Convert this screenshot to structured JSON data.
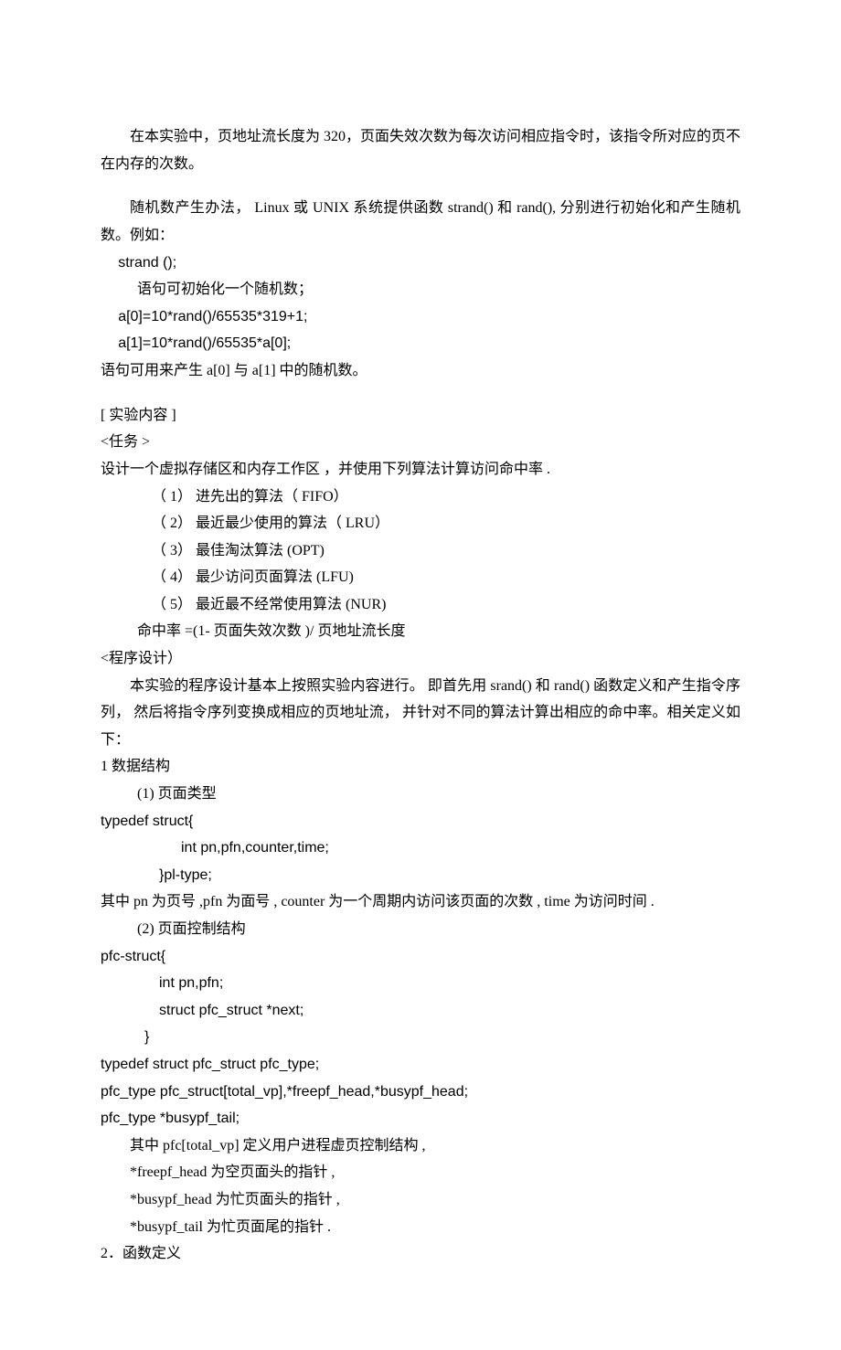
{
  "p1": "在本实验中，页地址流长度为 320，页面失效次数为每次访问相应指令时，该指令所对应的页不在内存的次数。",
  "p2": "随机数产生办法，  Linux 或 UNIX 系统提供函数 strand() 和 rand(), 分别进行初始化和产生随机数。例如：",
  "p3": "strand ();",
  "p4": "语句可初始化一个随机数；",
  "p5": "a[0]=10*rand()/65535*319+1;",
  "p6": "a[1]=10*rand()/65535*a[0];",
  "p7": "语句可用来产生   a[0] 与 a[1] 中的随机数。",
  "h1": "[ 实验内容 ]",
  "task": "<任务 >",
  "taskDesc": "设计一个虚拟存储区和内存工作区       ，并使用下列算法计算访问命中率       .",
  "alg1": "（ 1）    进先出的算法（  FIFO）",
  "alg2": "（ 2）    最近最少使用的算法（    LRU）",
  "alg3": "（ 3）    最佳淘汰算法  (OPT)",
  "alg4": "（ 4）    最少访问页面算法  (LFU)",
  "alg5": "（ 5）    最近最不经常使用算法     (NUR)",
  "hit": "命中率 =(1- 页面失效次数  )/ 页地址流长度",
  "prog": "<程序设计）",
  "progDesc": "本实验的程序设计基本上按照实验内容进行。       即首先用   srand()   和  rand()   函数定义和产生指令序列，   然后将指令序列变换成相应的页地址流，       并针对不同的算法计算出相应的命中率。相关定义如下：",
  "dsh": "1 数据结构",
  "ds1": "(1) 页面类型",
  "code1a": " typedef struct{",
  "code1b": " int pn,pfn,counter,time;",
  "code1c": "}pl-type;",
  "ds1desc": "其中 pn 为页号 ,pfn    为面号  , counter         为一个周期内访问该页面的次数  , time         为访问时间    .",
  "ds2": "(2)    页面控制结构",
  "code2a": "pfc-struct{",
  "code2b": " int pn,pfn;",
  "code2c": " struct pfc_struct *next;",
  "code2d": "}",
  "code2e": "typedef    struct pfc_struct pfc_type;",
  "code2f": "pfc_type pfc_struct[total_vp],*freepf_head,*busypf_head;",
  "code2g": "pfc_type *busypf_tail;",
  "ds2desc1": "其中 pfc[total_vp]       定义用户进程虚页控制结构     ,",
  "ds2desc2": "*freepf_head     为空页面头的指针    ,",
  "ds2desc3": "*busypf_head    为忙页面头的指针    ,",
  "ds2desc4": "*busypf_tail       为忙页面尾的指针     .",
  "funcdef": "2．函数定义"
}
